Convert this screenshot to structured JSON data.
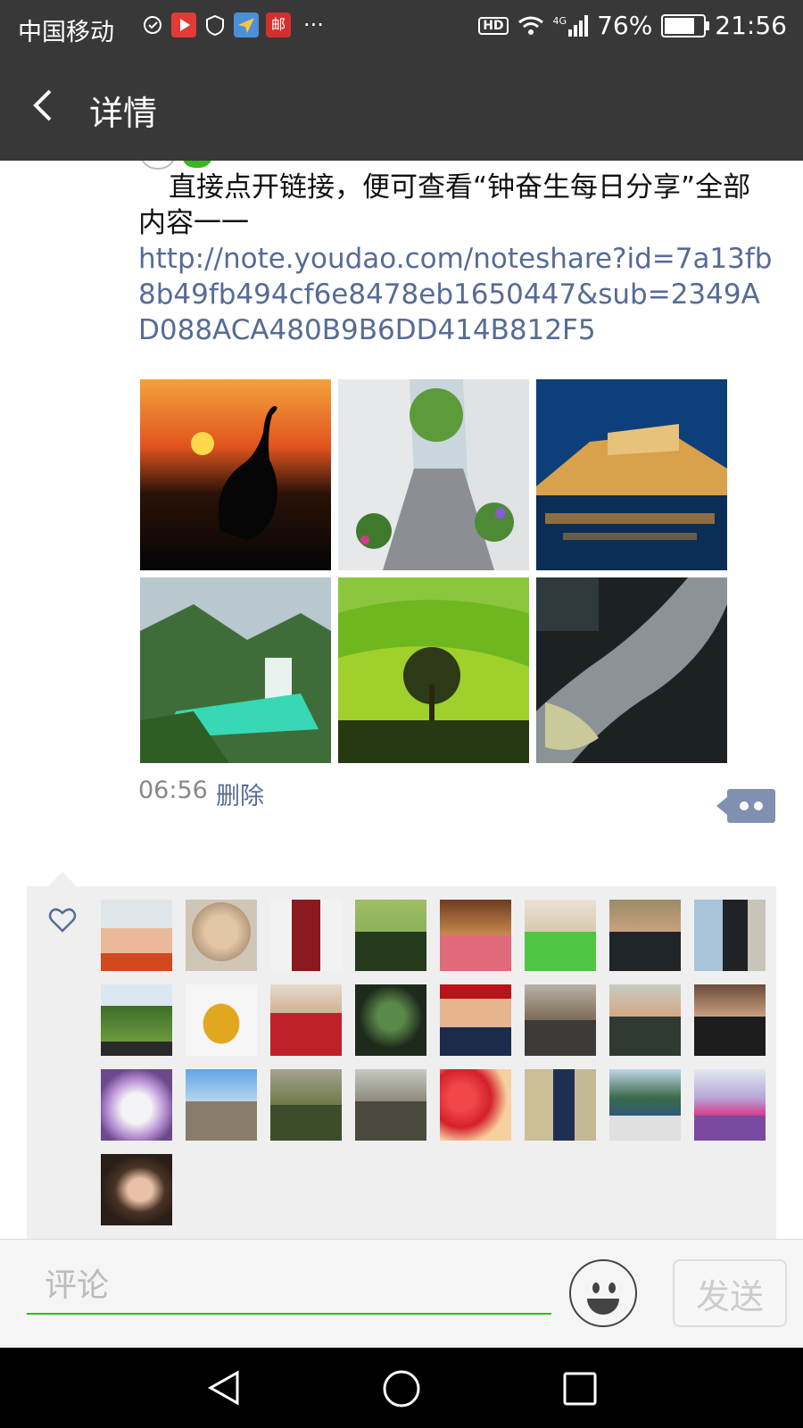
{
  "status_bar": {
    "carrier": "中国移动",
    "more": "···",
    "hd": "HD",
    "network": "4G",
    "battery": "76%",
    "time": "21:56"
  },
  "nav": {
    "title": "详情",
    "back_icon": "back-arrow-icon"
  },
  "post": {
    "text": "直接点开链接，便可查看“钟奋生每日分享”全部内容一一",
    "link": "http://note.youdao.com/noteshare?id=7a13fb8b49fb494cf6e8478eb1650447&sub=2349AD088ACA480B9B6DD414B812F5",
    "photos": [
      {
        "name": "sunset-crane-photo"
      },
      {
        "name": "flower-alley-photo"
      },
      {
        "name": "opera-house-photo"
      },
      {
        "name": "waterfall-valley-photo"
      },
      {
        "name": "green-hills-tree-photo"
      },
      {
        "name": "glacier-aerial-photo"
      }
    ],
    "time": "06:56",
    "delete_label": "删除"
  },
  "likes": {
    "icon": "heart-icon",
    "count": 25
  },
  "comment_bar": {
    "placeholder": "评论",
    "send_label": "发送"
  },
  "colors": {
    "bar_bg": "#383838",
    "link": "#576b95",
    "accent_green": "#3cb521",
    "likes_bg": "#efefef"
  }
}
